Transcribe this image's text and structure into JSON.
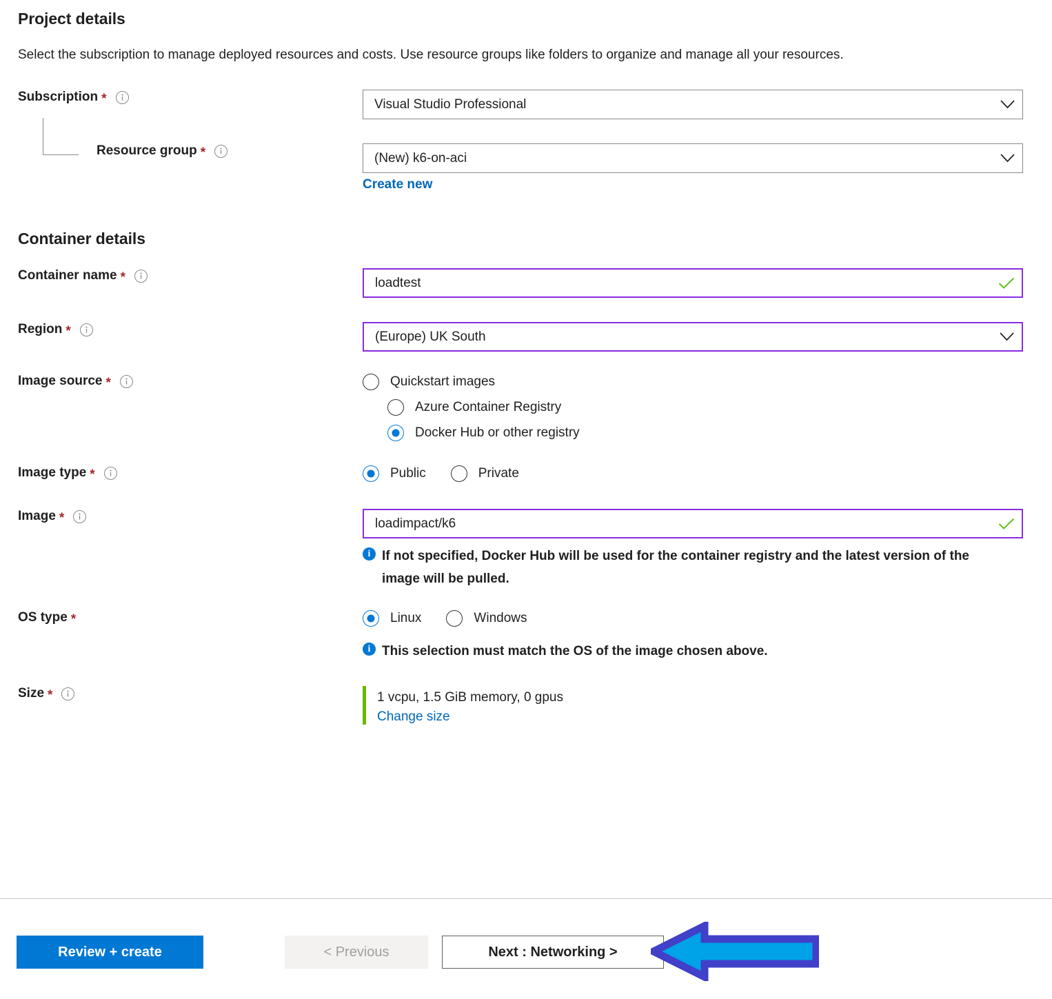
{
  "project": {
    "heading": "Project details",
    "description": "Select the subscription to manage deployed resources and costs. Use resource groups like folders to organize and manage all your resources.",
    "subscription": {
      "label": "Subscription",
      "required": "*",
      "value": "Visual Studio Professional",
      "info_icon": "info-icon",
      "chevron_icon": "chevron-down-icon"
    },
    "resource_group": {
      "label": "Resource group",
      "required": "*",
      "value": "(New) k6-on-aci",
      "create_new_link": "Create new",
      "info_icon": "info-icon",
      "chevron_icon": "chevron-down-icon"
    }
  },
  "container": {
    "heading": "Container details",
    "container_name": {
      "label": "Container name",
      "required": "*",
      "value": "loadtest",
      "valid_icon": "checkmark-icon"
    },
    "region": {
      "label": "Region",
      "required": "*",
      "value": "(Europe) UK South",
      "chevron_icon": "chevron-down-icon"
    },
    "image_source": {
      "label": "Image source",
      "required": "*",
      "options": [
        {
          "label": "Quickstart images",
          "selected": false
        },
        {
          "label": "Azure Container Registry",
          "selected": false
        },
        {
          "label": "Docker Hub or other registry",
          "selected": true
        }
      ]
    },
    "image_type": {
      "label": "Image type",
      "required": "*",
      "options": [
        {
          "label": "Public",
          "selected": true
        },
        {
          "label": "Private",
          "selected": false
        }
      ]
    },
    "image": {
      "label": "Image",
      "required": "*",
      "value": "loadimpact/k6",
      "valid_icon": "checkmark-icon",
      "hint": "If not specified, Docker Hub will be used for the container registry and the latest version of the image will be pulled.",
      "hint_icon": "info-filled-icon"
    },
    "os_type": {
      "label": "OS type",
      "required": "*",
      "options": [
        {
          "label": "Linux",
          "selected": true
        },
        {
          "label": "Windows",
          "selected": false
        }
      ],
      "hint": "This selection must match the OS of the image chosen above.",
      "hint_icon": "info-filled-icon"
    },
    "size": {
      "label": "Size",
      "required": "*",
      "value": "1 vcpu, 1.5 GiB memory, 0 gpus",
      "change_link": "Change size"
    }
  },
  "footer": {
    "review_create": "Review + create",
    "previous": "< Previous",
    "next": "Next : Networking >"
  },
  "annotation": {
    "arrow_icon": "left-arrow-annotation",
    "fill_color": "#00a2e8",
    "outline_color": "#4040c8"
  },
  "colors": {
    "accent_blue": "#0078d4",
    "link_blue": "#0067b8",
    "valid_purple": "#8a2be2",
    "required_red": "#a4262c",
    "success_green": "#6bb700"
  }
}
